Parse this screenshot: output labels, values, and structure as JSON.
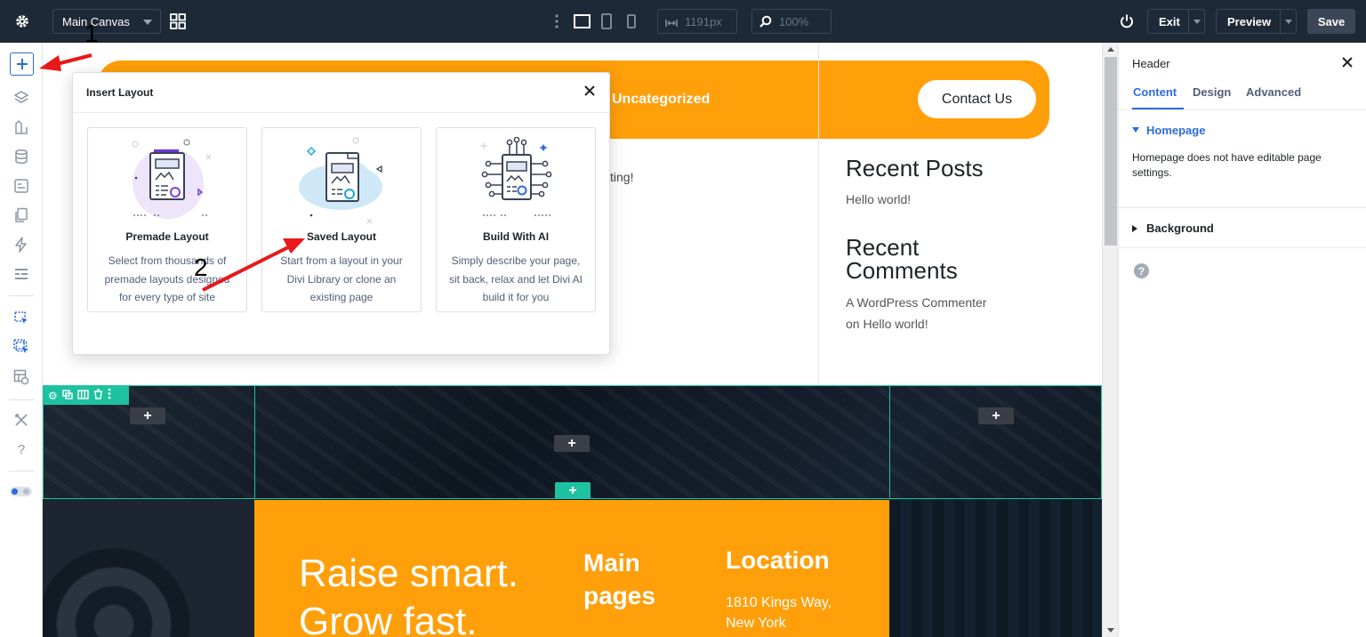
{
  "topbar": {
    "canvas_select": "Main Canvas",
    "width_value": "1191px",
    "zoom_value": "100%",
    "exit_label": "Exit",
    "preview_label": "Preview",
    "save_label": "Save"
  },
  "page": {
    "nav_category": "Uncategorized",
    "contact_button": "Contact Us",
    "body_fragment": "ting!",
    "recent_posts_title": "Recent Posts",
    "recent_post_1": "Hello world!",
    "recent_comments_title": "Recent Comments",
    "comment_line_1": "A WordPress Commenter",
    "comment_line_2": "on Hello world!",
    "footer": {
      "headline_1": "Raise smart.",
      "headline_2": "Grow fast.",
      "main_pages_1": "Main",
      "main_pages_2": "pages",
      "location_title": "Location",
      "address_1": "1810 Kings Way,",
      "address_2": "New York"
    }
  },
  "modal": {
    "title": "Insert Layout",
    "cards": [
      {
        "title": "Premade Layout",
        "lines": [
          "Select from thousands of",
          "premade layouts designed",
          "for every type of site"
        ]
      },
      {
        "title": "Saved Layout",
        "lines": [
          "Start from a layout in your",
          "Divi Library or clone an",
          "existing page"
        ]
      },
      {
        "title": "Build With AI",
        "lines": [
          "Simply describe your page,",
          "sit back, relax and let Divi AI",
          "build it for you"
        ]
      }
    ]
  },
  "annotations": {
    "step_1": "1",
    "step_2": "2"
  },
  "rightpanel": {
    "title": "Header",
    "tabs": [
      "Content",
      "Design",
      "Advanced"
    ],
    "section_homepage": "Homepage",
    "homepage_note_1": "Homepage does not have editable page",
    "homepage_note_2": "settings.",
    "section_background": "Background"
  },
  "colors": {
    "topbar": "#1e2937",
    "accent_blue": "#2b6cdd",
    "orange": "#ff9f0a",
    "teal": "#1fc2a0",
    "dark_section": "#0f1822",
    "arrow_red": "#e8181b"
  }
}
